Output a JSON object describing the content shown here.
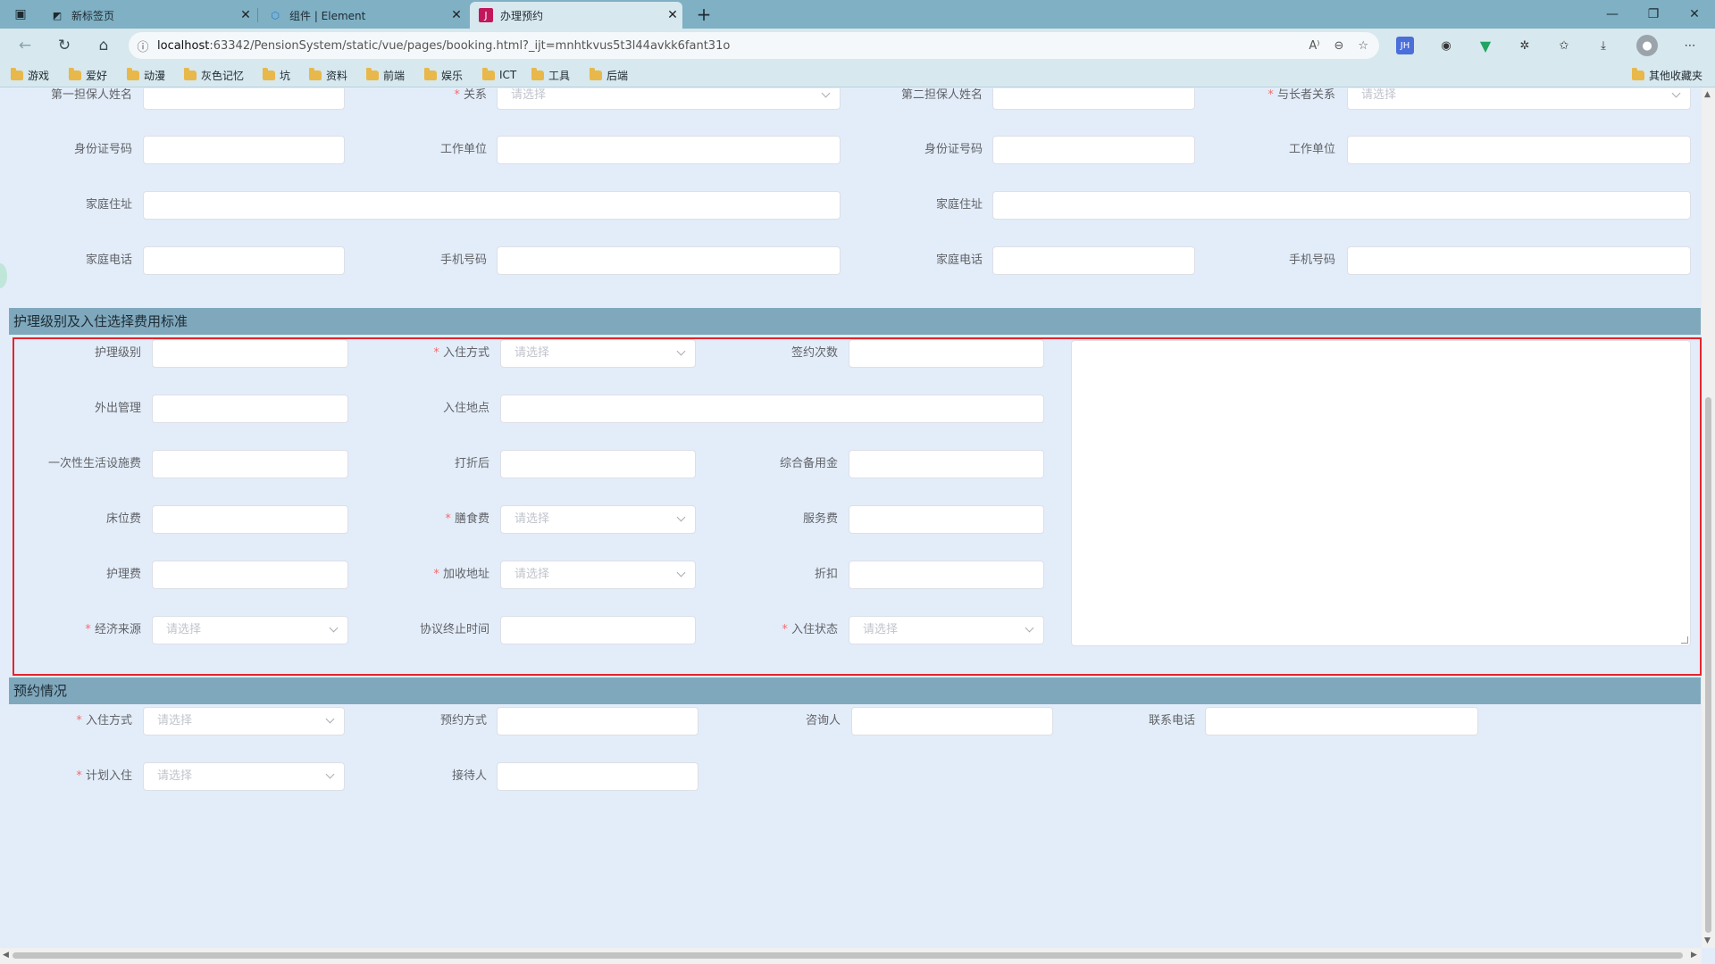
{
  "tabs": [
    {
      "label": "新标签页",
      "icon": "tab-icon"
    },
    {
      "label": "组件 | Element",
      "icon": "element-logo-icon"
    },
    {
      "label": "办理预约",
      "icon": "jetbrains-icon"
    }
  ],
  "url": {
    "host": "localhost",
    "rest": ":63342/PensionSystem/static/vue/pages/booking.html?_ijt=mnhtkvus5t3l44avkk6fant31o"
  },
  "bookmarks": [
    "游戏",
    "爱好",
    "动漫",
    "灰色记忆",
    "坑",
    "资料",
    "前端",
    "娱乐",
    "ICT",
    "工具",
    "后端"
  ],
  "bookmarks_other": "其他收藏夹",
  "guarantor": {
    "row0": {
      "a": "第一担保人姓名",
      "b": "关系",
      "c": "第二担保人姓名",
      "d": "与长者关系",
      "placeholder": "请选择"
    },
    "row1": {
      "a": "身份证号码",
      "b": "工作单位",
      "c": "身份证号码",
      "d": "工作单位"
    },
    "row2": {
      "a": "家庭住址",
      "c": "家庭住址"
    },
    "row3": {
      "a": "家庭电话",
      "b": "手机号码",
      "c": "家庭电话",
      "d": "手机号码"
    }
  },
  "care": {
    "title": "护理级别及入住选择费用标准",
    "placeholder": "请选择",
    "labels": {
      "care_level": "护理级别",
      "checkin_method": "入住方式",
      "sign_count": "签约次数",
      "outing_mgmt": "外出管理",
      "checkin_place": "入住地点",
      "facility_fee": "一次性生活设施费",
      "discounted": "打折后",
      "reserve_fund": "综合备用金",
      "bed_fee": "床位费",
      "meal_fee": "膳食费",
      "service_fee": "服务费",
      "care_fee": "护理费",
      "billing_addr": "加收地址",
      "discount": "折扣",
      "income_source": "经济来源",
      "agreement_end": "协议终止时间",
      "checkin_status": "入住状态"
    }
  },
  "booking": {
    "title": "预约情况",
    "placeholder": "请选择",
    "labels": {
      "checkin_method": "入住方式",
      "booking_method": "预约方式",
      "consultant": "咨询人",
      "contact_phone": "联系电话",
      "planned_checkin": "计划入住",
      "receptionist": "接待人"
    }
  }
}
